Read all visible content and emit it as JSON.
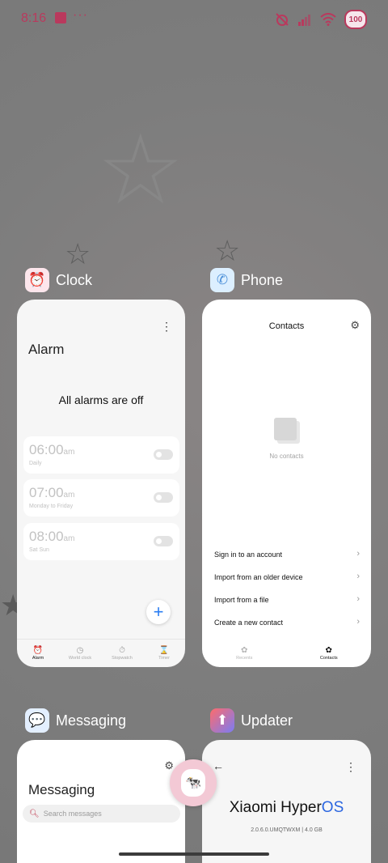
{
  "status_bar": {
    "time": "8:16",
    "dots": "···",
    "battery": "100",
    "accent_color": "#b9395d"
  },
  "apps": {
    "clock": {
      "name": "Clock",
      "title": "Alarm",
      "empty_message": "All alarms are off",
      "alarms": [
        {
          "time": "06:00",
          "ampm": "am",
          "repeat": "Daily",
          "enabled": false
        },
        {
          "time": "07:00",
          "ampm": "am",
          "repeat": "Monday to Friday",
          "enabled": false
        },
        {
          "time": "08:00",
          "ampm": "am",
          "repeat": "Sat Sun",
          "enabled": false
        }
      ],
      "tabs": [
        "Alarm",
        "World clock",
        "Stopwatch",
        "Timer"
      ],
      "active_tab": "Alarm"
    },
    "phone": {
      "name": "Phone",
      "title": "Contacts",
      "empty_message": "No contacts",
      "options": [
        "Sign in to an account",
        "Import from an older device",
        "Import from a file",
        "Create a new contact"
      ],
      "tabs": [
        "Recents",
        "Contacts"
      ],
      "active_tab": "Contacts"
    },
    "messaging": {
      "name": "Messaging",
      "title": "Messaging",
      "search_placeholder": "Search messages"
    },
    "updater": {
      "name": "Updater",
      "brand_prefix": "Xiaomi Hyper",
      "brand_suffix": "OS",
      "version": "2.0.6.0.UMQTWXM | 4.0 GB"
    }
  },
  "icons": {
    "clock": "alarm-clock-icon",
    "phone": "phone-icon",
    "messaging": "chat-bubble-icon",
    "updater": "update-arrow-icon"
  }
}
